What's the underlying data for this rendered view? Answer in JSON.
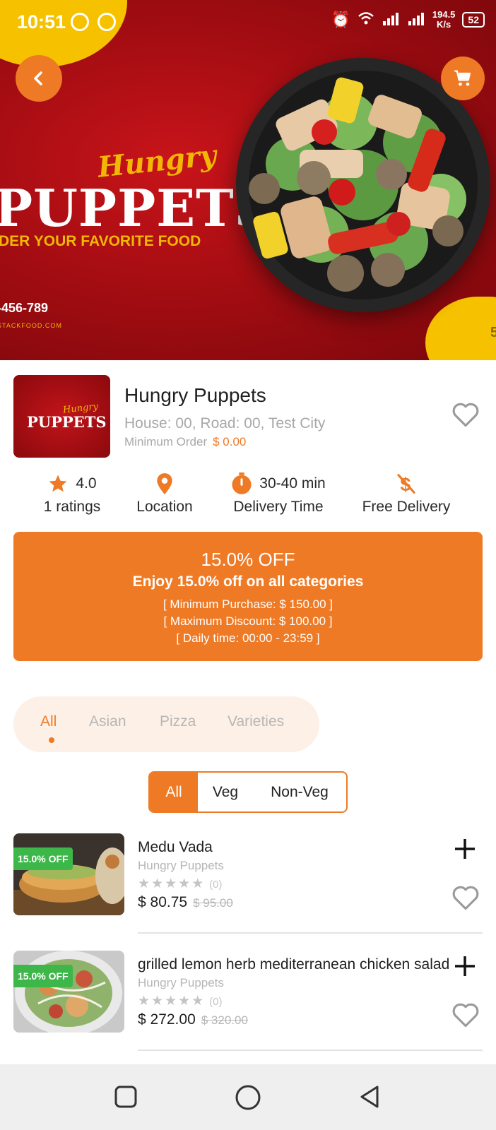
{
  "status_bar": {
    "time": "10:51",
    "speed_value": "194.5",
    "speed_unit": "K/s",
    "battery": "52"
  },
  "banner": {
    "brand_script": "Hungry",
    "brand_main": "PUPPETS",
    "tagline": "DER YOUR FAVORITE FOOD",
    "phone": "-456-789",
    "website": "STACKFOOD.COM",
    "corner_text": "5"
  },
  "restaurant": {
    "logo_script": "Hungry",
    "logo_main": "PUPPETS",
    "name": "Hungry Puppets",
    "address": "House: 00, Road: 00, Test City",
    "min_order_label": "Minimum Order",
    "min_order_value": "$ 0.00"
  },
  "stats": {
    "rating_value": "4.0",
    "rating_label": "1 ratings",
    "location_label": "Location",
    "delivery_time_value": "30-40 min",
    "delivery_time_label": "Delivery Time",
    "free_delivery_label": "Free Delivery"
  },
  "offer": {
    "title": "15.0% OFF",
    "subtitle": "Enjoy 15.0% off on all categories",
    "line1": "[ Minimum Purchase: $ 150.00 ]",
    "line2": "[ Maximum Discount: $ 100.00 ]",
    "line3": "[ Daily time: 00:00 - 23:59 ]"
  },
  "categories": [
    "All",
    "Asian",
    "Pizza",
    "Varieties"
  ],
  "diet_filter": [
    "All",
    "Veg",
    "Non-Veg"
  ],
  "products": [
    {
      "badge": "15.0% OFF",
      "name": "Medu Vada",
      "restaurant": "Hungry Puppets",
      "stars": "★★★★★",
      "rating_count": "(0)",
      "price": "$ 80.75",
      "old_price": "$ 95.00"
    },
    {
      "badge": "15.0% OFF",
      "name": "grilled lemon herb mediterranean chicken salad",
      "restaurant": "Hungry Puppets",
      "stars": "★★★★★",
      "rating_count": "(0)",
      "price": "$ 272.00",
      "old_price": "$ 320.00"
    }
  ],
  "colors": {
    "accent": "#ef7a25",
    "banner_red": "#a40d12",
    "badge_green": "#3db64a"
  }
}
